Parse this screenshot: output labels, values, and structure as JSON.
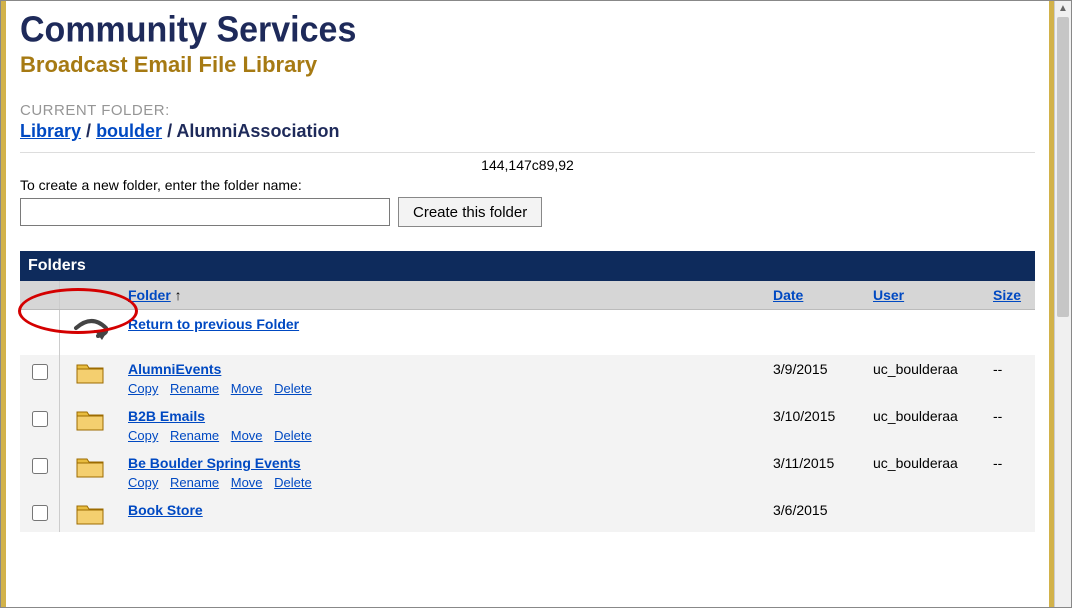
{
  "header": {
    "app_title": "Community Services",
    "sub_title": "Broadcast Email File Library"
  },
  "breadcrumb": {
    "label": "CURRENT FOLDER:",
    "library": "Library",
    "campus": "boulder",
    "current": "AlumniAssociation",
    "sep": " / "
  },
  "mystery_text": "144,147c89,92",
  "create": {
    "prompt": "To create a new folder, enter the folder name:",
    "button": "Create this folder"
  },
  "band_label": "Folders",
  "columns": {
    "folder": "Folder",
    "sort_indicator": "↑",
    "date": "Date",
    "user": "User",
    "size": "Size"
  },
  "return_link": "Return to previous Folder",
  "actions": {
    "copy": "Copy",
    "rename": "Rename",
    "move": "Move",
    "delete": "Delete"
  },
  "rows": [
    {
      "name": "AlumniEvents",
      "date": "3/9/2015",
      "user": "uc_boulderaa",
      "size": "--"
    },
    {
      "name": "B2B Emails",
      "date": "3/10/2015",
      "user": "uc_boulderaa",
      "size": "--"
    },
    {
      "name": "Be Boulder Spring Events",
      "date": "3/11/2015",
      "user": "uc_boulderaa",
      "size": "--"
    },
    {
      "name": "Book Store",
      "date": "3/6/2015",
      "user": "",
      "size": ""
    }
  ]
}
